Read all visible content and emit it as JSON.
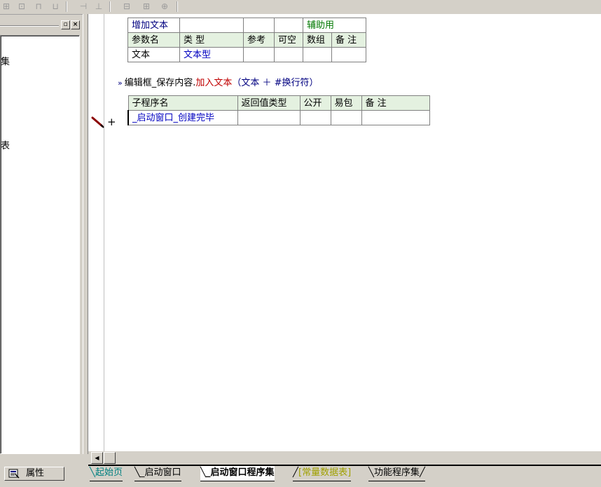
{
  "left_panel": {
    "tree_items": [
      "集",
      "表"
    ]
  },
  "property_button": {
    "label": "属性"
  },
  "param_table": {
    "title_row": [
      "增加文本",
      "",
      "",
      "",
      "辅助用",
      ""
    ],
    "header_row": [
      "参数名",
      "类 型",
      "参考",
      "可空",
      "数组",
      "备 注"
    ],
    "data_row": [
      "文本",
      "文本型",
      "",
      "",
      "",
      ""
    ]
  },
  "code_line": {
    "prefix": "编辑框_保存内容.",
    "method": "加入文本",
    "args": "（文本 ＋ #换行符）"
  },
  "sub_table": {
    "header_row": [
      "子程序名",
      "返回值类型",
      "公开",
      "易包",
      "备 注"
    ],
    "data_row": [
      "_启动窗口_创建完毕",
      "",
      "",
      "",
      ""
    ]
  },
  "gutter": {
    "plus": "+"
  },
  "tabs": [
    {
      "label": "起始页",
      "color": "#008080"
    },
    {
      "label": "_启动窗口",
      "color": "#000000"
    },
    {
      "label": "_启动窗口程序集",
      "color": "#000000",
      "active": true
    },
    {
      "label": "[常量数据表]",
      "color": "#a0a000"
    },
    {
      "label": "功能程序集",
      "color": "#000000"
    }
  ]
}
